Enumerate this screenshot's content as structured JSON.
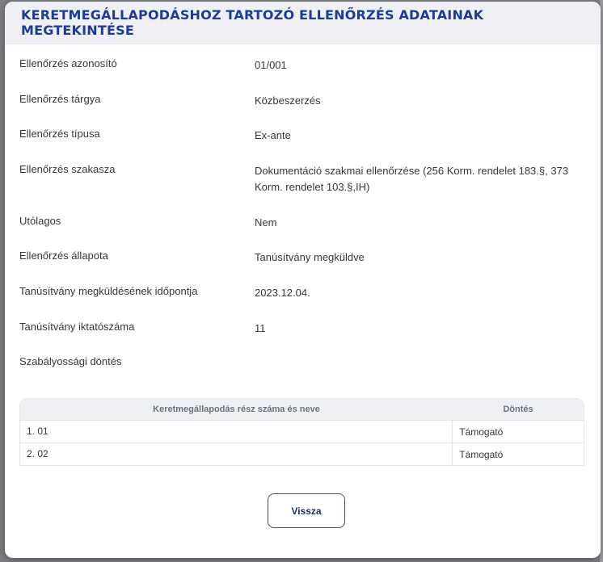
{
  "modal": {
    "title": "KERETMEGÁLLAPODÁSHOZ TARTOZÓ ELLENŐRZÉS ADATAINAK MEGTEKINTÉSE"
  },
  "details": [
    {
      "label": "Ellenőrzés azonosító",
      "value": "01/001"
    },
    {
      "label": "Ellenőrzés tárgya",
      "value": "Közbeszerzés"
    },
    {
      "label": "Ellenőrzés típusa",
      "value": "Ex-ante"
    },
    {
      "label": "Ellenőrzés szakasza",
      "value": "Dokumentáció szakmai ellenőrzése (256 Korm. rendelet 183.§, 373 Korm. rendelet 103.§,IH)"
    },
    {
      "label": "Utólagos",
      "value": "Nem"
    },
    {
      "label": "Ellenőrzés állapota",
      "value": "Tanúsítvány megküldve"
    },
    {
      "label": "Tanúsítvány megküldésének időpontja",
      "value": "2023.12.04."
    },
    {
      "label": "Tanúsítvány iktatószáma",
      "value": "11"
    },
    {
      "label": "Szabályossági döntés",
      "value": ""
    }
  ],
  "table": {
    "headers": {
      "name": "Keretmegállapodás rész száma és neve",
      "decision": "Döntés"
    },
    "rows": [
      {
        "name": "1. 01",
        "decision": "Támogató"
      },
      {
        "name": "2. 02",
        "decision": "Támogató"
      }
    ]
  },
  "buttons": {
    "back": "Vissza"
  }
}
